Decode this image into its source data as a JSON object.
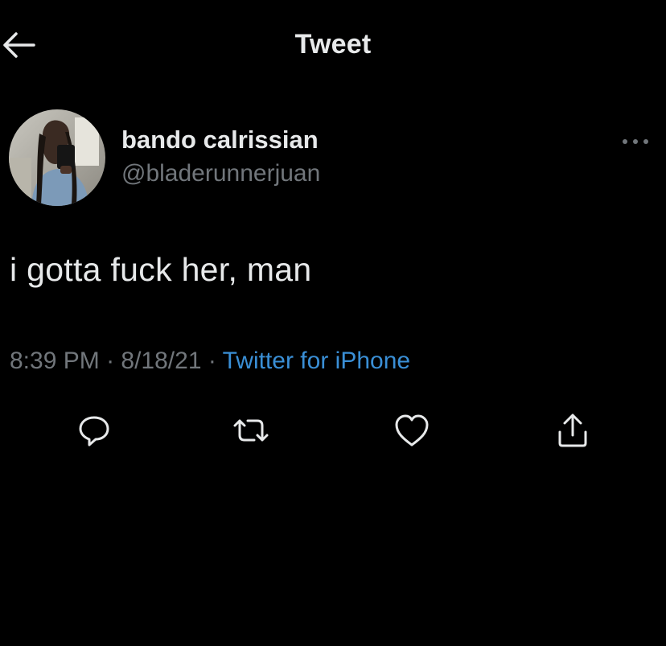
{
  "header": {
    "title": "Tweet",
    "back_icon": "arrow-left-icon"
  },
  "author": {
    "display_name": "bando calrissian",
    "handle": "@bladerunnerjuan",
    "avatar_icon": "avatar-photo"
  },
  "tweet": {
    "text": "i gotta fuck her, man",
    "time": "8:39 PM",
    "separator1": " · ",
    "date": "8/18/21",
    "separator2": " · ",
    "source": "Twitter for iPhone"
  },
  "actions": {
    "reply_icon": "reply-icon",
    "retweet_icon": "retweet-icon",
    "like_icon": "heart-icon",
    "share_icon": "share-icon"
  },
  "colors": {
    "background": "#000000",
    "primary_text": "#e7e9ea",
    "secondary_text": "#71767b",
    "link": "#3a8fd6"
  }
}
